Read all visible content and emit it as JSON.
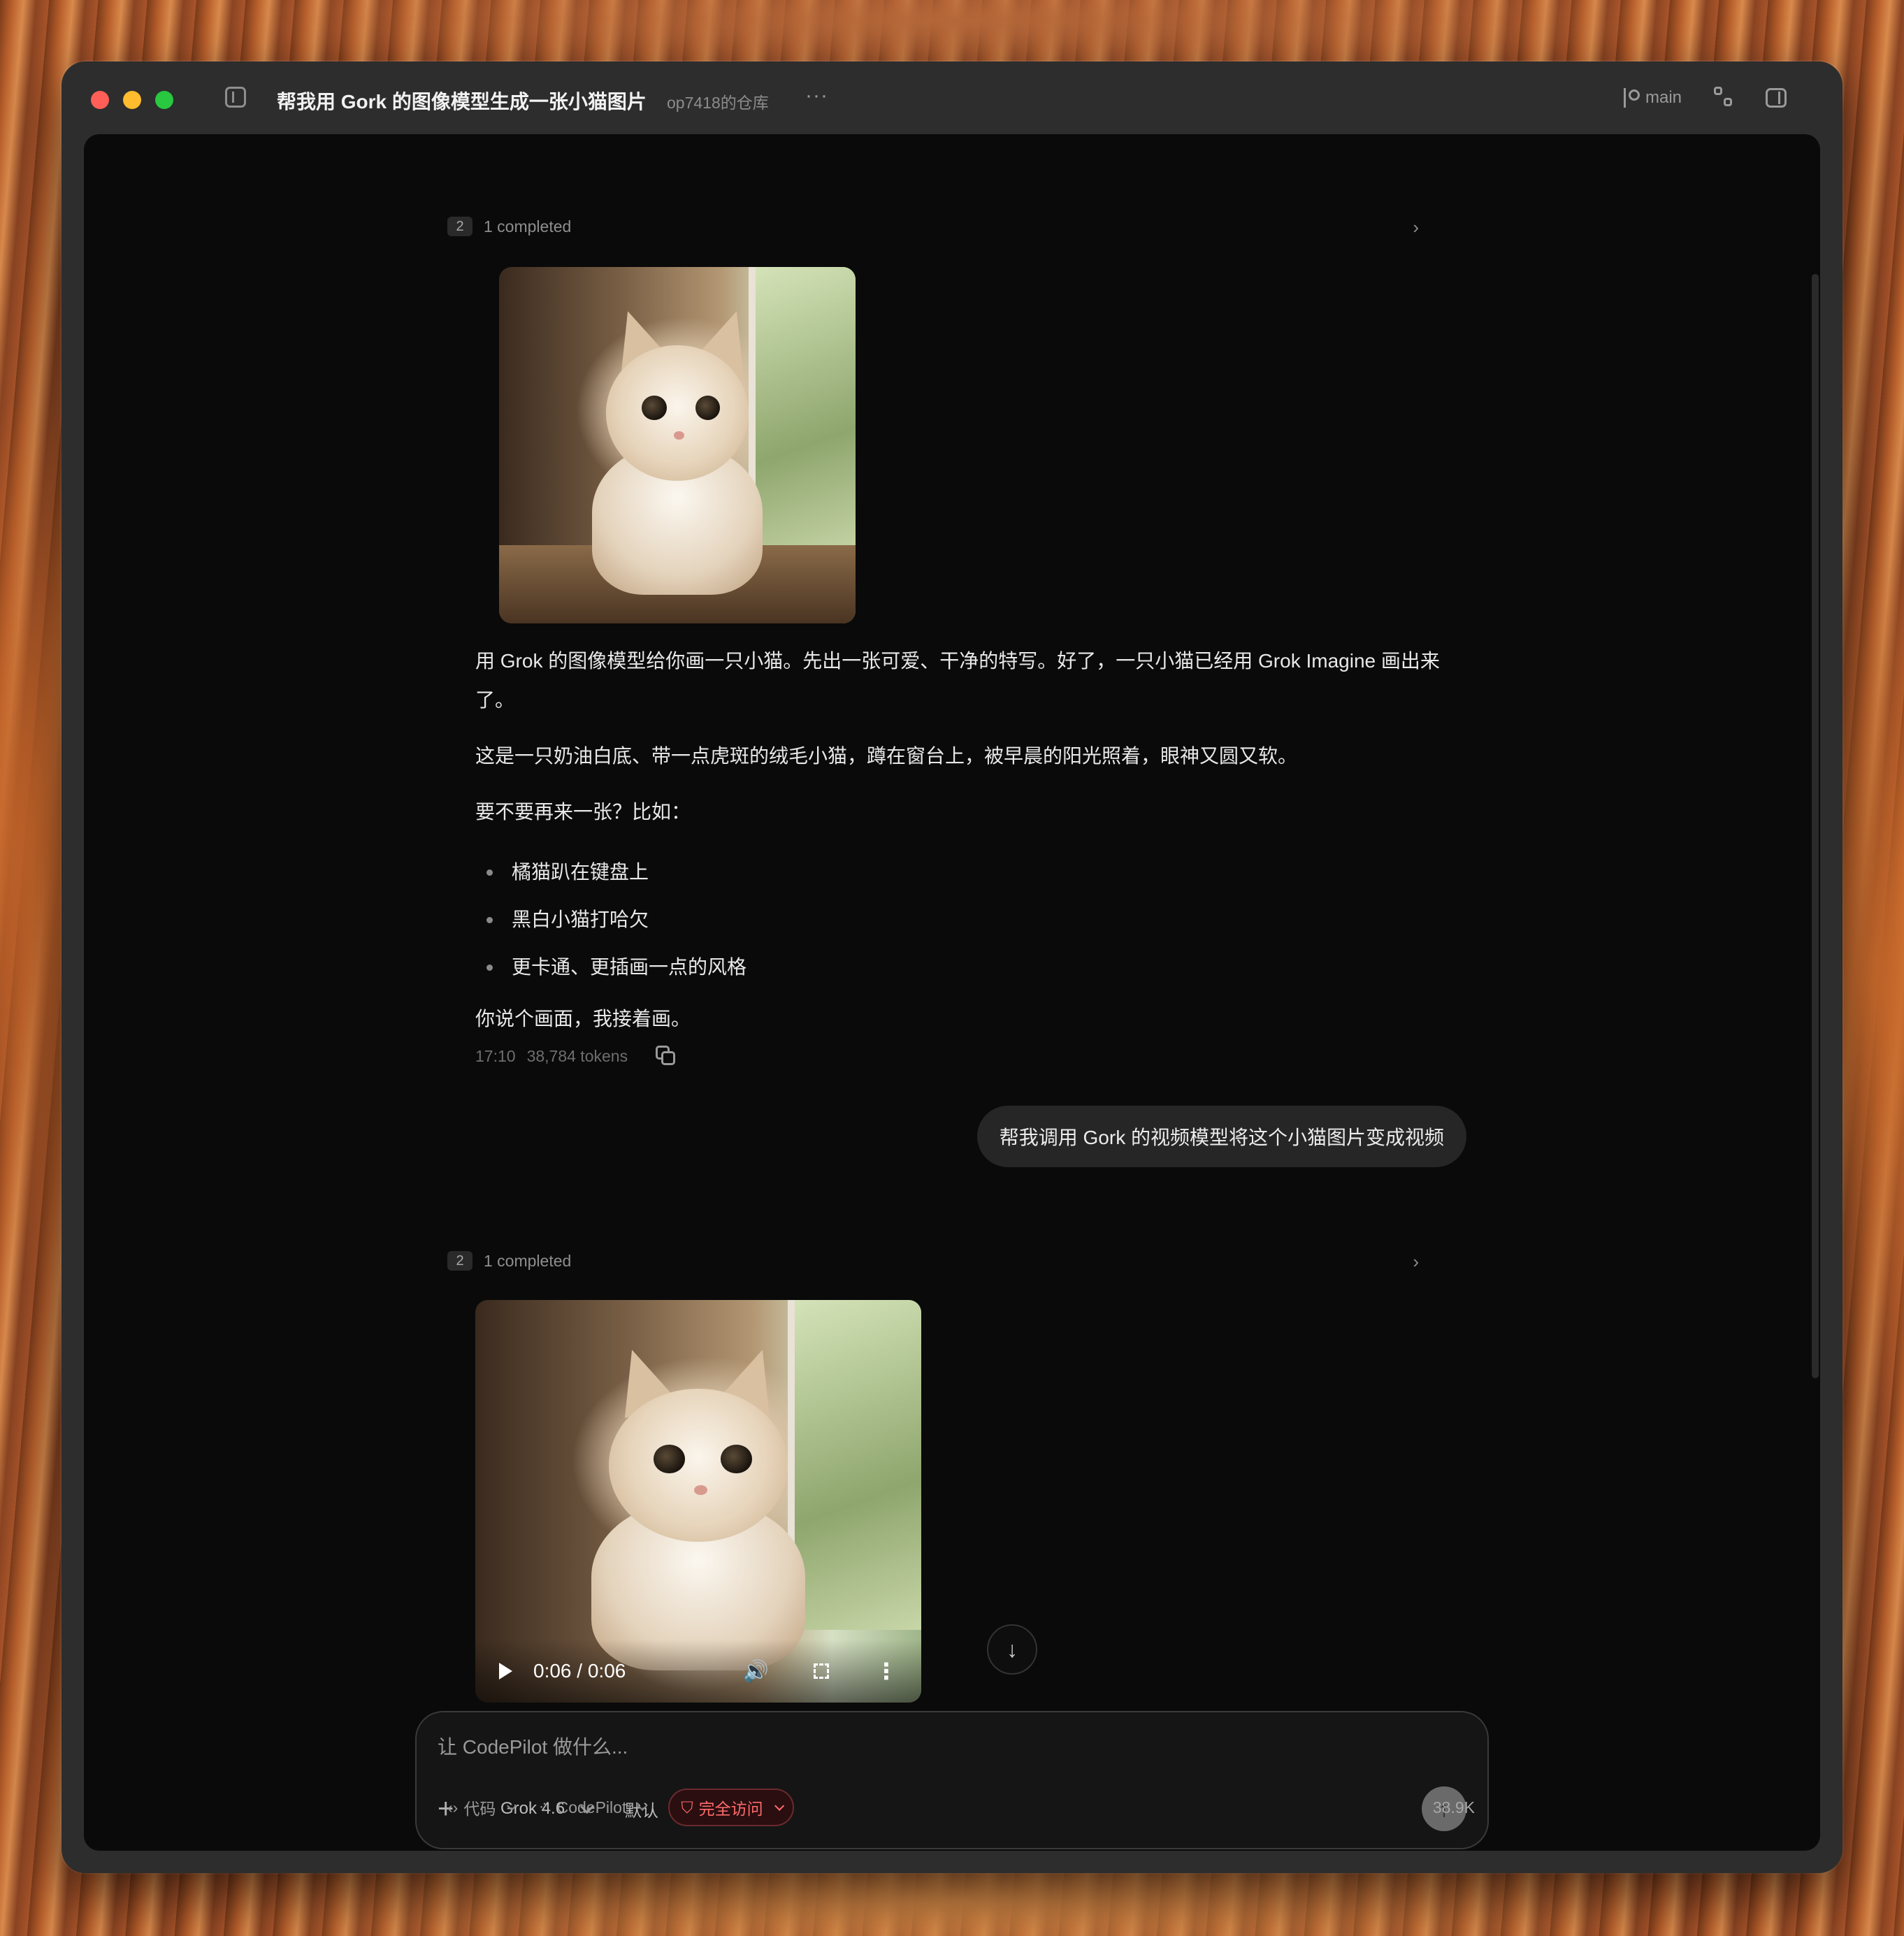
{
  "window": {
    "title": "帮我用 Gork 的图像模型生成一张小猫图片",
    "repo": "op7418的仓库",
    "more": "···",
    "branch": "main"
  },
  "messages": {
    "task1": {
      "count": "2",
      "label": "1 completed"
    },
    "assistant1": {
      "para1": "用 Grok 的图像模型给你画一只小猫。先出一张可爱、干净的特写。好了，一只小猫已经用 Grok Imagine 画出来了。",
      "para2": "这是一只奶油白底、带一点虎斑的绒毛小猫，蹲在窗台上，被早晨的阳光照着，眼神又圆又软。",
      "para3": "要不要再来一张？比如：",
      "bullets": [
        "橘猫趴在键盘上",
        "黑白小猫打哈欠",
        "更卡通、更插画一点的风格"
      ],
      "para4": "你说个画面，我接着画。",
      "time": "17:10",
      "tokens": "38,784 tokens"
    },
    "user1": "帮我调用 Gork 的视频模型将这个小猫图片变成视频",
    "task2": {
      "count": "2",
      "label": "1 completed"
    },
    "video": {
      "current": "0:06",
      "sep": "/",
      "duration": "0:06"
    }
  },
  "composer": {
    "placeholder": "让 CodePilot 做什么...",
    "model": "Grok 4.6",
    "mode": "默认"
  },
  "status": {
    "code_label": "代码",
    "agent_label": "CodePilot",
    "access_label": "完全访问",
    "context_tokens": "38.9K"
  }
}
